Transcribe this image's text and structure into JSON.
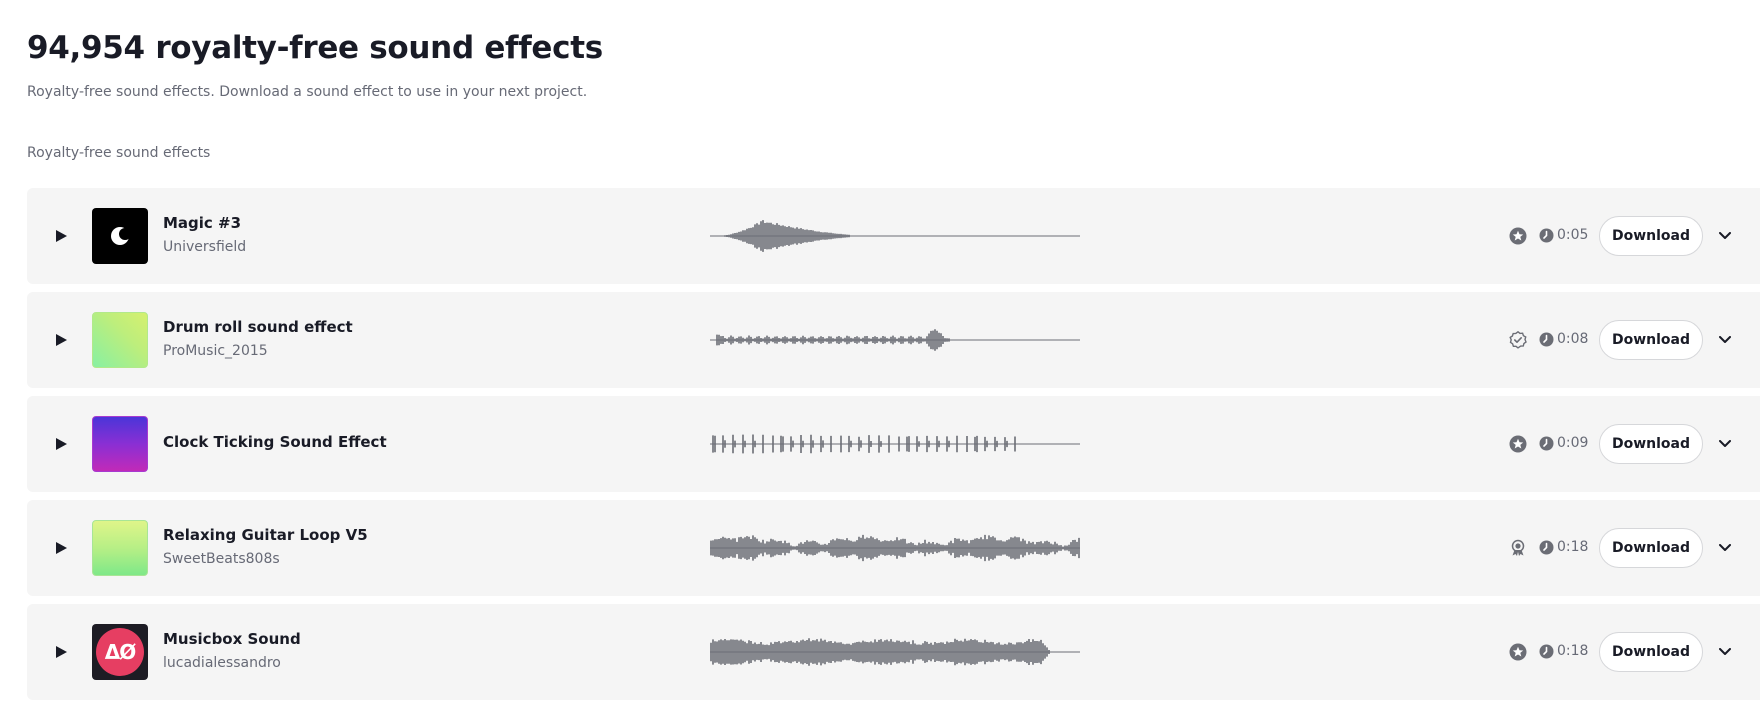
{
  "header": {
    "title": "94,954 royalty-free sound effects",
    "subtitle": "Royalty-free sound effects. Download a sound effect to use in your next project.",
    "section_label": "Royalty-free sound effects"
  },
  "colors": {
    "text": "#191b26",
    "muted": "#676a76",
    "row_bg": "#f5f5f5",
    "waveform": "#6b6d75"
  },
  "tracks": [
    {
      "title": "Magic #3",
      "artist": "Universfield",
      "duration": "0:05",
      "download_label": "Download",
      "badge_icon": "star-badge-icon",
      "thumbnail": "moon-logo-black"
    },
    {
      "title": "Drum roll sound effect",
      "artist": "ProMusic_2015",
      "duration": "0:08",
      "download_label": "Download",
      "badge_icon": "verified-badge-icon",
      "thumbnail": "green-gradient"
    },
    {
      "title": "Clock Ticking Sound Effect",
      "artist": "",
      "duration": "0:09",
      "download_label": "Download",
      "badge_icon": "star-badge-icon",
      "thumbnail": "purple-gradient"
    },
    {
      "title": "Relaxing Guitar Loop V5",
      "artist": "SweetBeats808s",
      "duration": "0:18",
      "download_label": "Download",
      "badge_icon": "award-badge-icon",
      "thumbnail": "lime-gradient"
    },
    {
      "title": "Musicbox Sound",
      "artist": "lucadialessandro",
      "duration": "0:18",
      "download_label": "Download",
      "badge_icon": "star-badge-icon",
      "thumbnail": "red-circle-logo",
      "logo_text": "ΔØ"
    }
  ]
}
